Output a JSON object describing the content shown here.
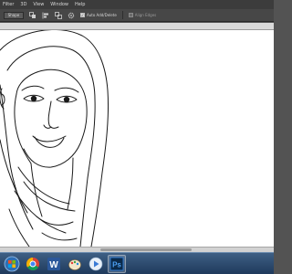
{
  "menubar": {
    "items": [
      "Filter",
      "3D",
      "View",
      "Window",
      "Help"
    ]
  },
  "options": {
    "shape_select": "Shape",
    "auto_add_delete": "Auto Add/Delete",
    "align_edges": "Align Edges",
    "auto_add_checked": true
  },
  "taskbar": {
    "apps": [
      {
        "name": "start-orb-icon",
        "active": false
      },
      {
        "name": "chrome-icon",
        "active": false
      },
      {
        "name": "word-icon",
        "active": false
      },
      {
        "name": "paint-icon",
        "active": false
      },
      {
        "name": "media-player-icon",
        "active": false
      },
      {
        "name": "photoshop-icon",
        "active": true
      }
    ]
  },
  "colors": {
    "menubar_bg": "#3c3c3c",
    "options_bg": "#474747",
    "taskbar_top": "#3e5f84",
    "photoshop_blue": "#2a74c9"
  }
}
